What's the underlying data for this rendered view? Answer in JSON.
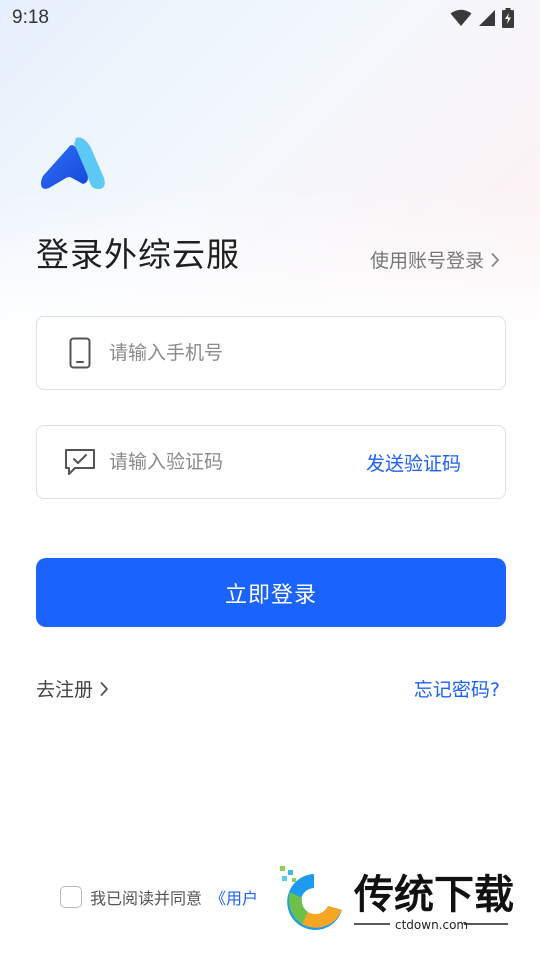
{
  "status_bar": {
    "time": "9:18",
    "icons": [
      "wifi-icon",
      "cellular-signal-icon",
      "battery-charging-icon"
    ]
  },
  "header": {
    "logo_icon": "app-logo",
    "title": "登录外综云服",
    "account_login_label": "使用账号登录"
  },
  "form": {
    "phone_placeholder": "请输入手机号",
    "phone_value": "",
    "code_placeholder": "请输入验证码",
    "code_value": "",
    "send_code_label": "发送验证码",
    "login_label": "立即登录"
  },
  "links": {
    "register_label": "去注册",
    "forgot_label": "忘记密码?"
  },
  "agreement": {
    "checked": false,
    "text": "我已阅读并同意",
    "link_text": "《用户"
  },
  "watermark": {
    "title": "传统下载",
    "url": "ctdown.com"
  },
  "colors": {
    "primary": "#1a63fc",
    "link": "#1e62f5",
    "logo_dark": "#1f5ff7",
    "logo_light": "#5cc9f7"
  }
}
